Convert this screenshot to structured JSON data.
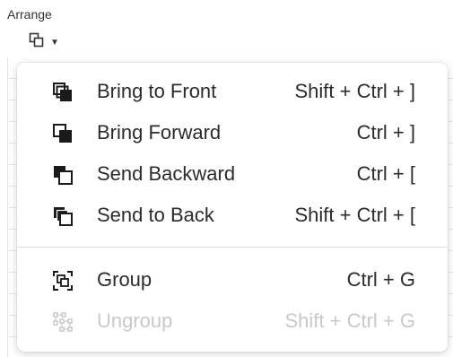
{
  "header": {
    "title": "Arrange",
    "arrange_button_icon": "arrange-icon",
    "caret_icon": "caret-down-icon"
  },
  "menu": {
    "items": [
      {
        "label": "Bring to Front",
        "shortcut": "Shift + Ctrl + ]",
        "icon": "bring-to-front-icon",
        "enabled": true
      },
      {
        "label": "Bring Forward",
        "shortcut": "Ctrl + ]",
        "icon": "bring-forward-icon",
        "enabled": true
      },
      {
        "label": "Send Backward",
        "shortcut": "Ctrl + [",
        "icon": "send-backward-icon",
        "enabled": true
      },
      {
        "label": "Send to Back",
        "shortcut": "Shift + Ctrl + [",
        "icon": "send-to-back-icon",
        "enabled": true
      },
      {
        "label": "Group",
        "shortcut": "Ctrl + G",
        "icon": "group-icon",
        "enabled": true
      },
      {
        "label": "Ungroup",
        "shortcut": "Shift + Ctrl + G",
        "icon": "ungroup-icon",
        "enabled": false
      }
    ]
  },
  "colors": {
    "text": "#2b2b2b",
    "disabled_text": "#c9c9c9",
    "icon": "#1a1a1a",
    "divider": "#dedede"
  }
}
